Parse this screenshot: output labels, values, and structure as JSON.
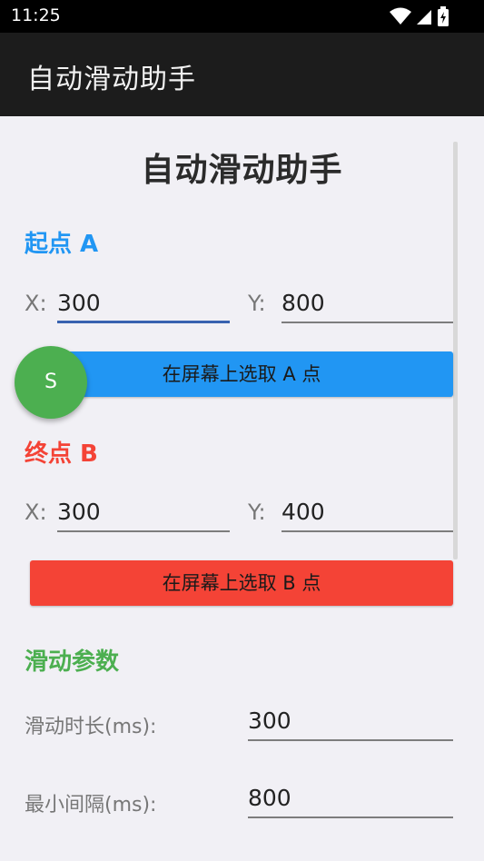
{
  "status": {
    "time": "11:25",
    "icons": [
      "wifi-icon",
      "signal-icon",
      "battery-icon"
    ]
  },
  "app_bar": {
    "title": "自动滑动助手"
  },
  "main": {
    "title": "自动滑动助手"
  },
  "start": {
    "heading": "起点 A",
    "heading_color": "#2196f3",
    "x_label": "X:",
    "x_value": "300",
    "y_label": "Y:",
    "y_value": "800",
    "button_label": "在屏幕上选取 A 点",
    "button_color": "#2196f3"
  },
  "fab": {
    "label": "S",
    "color": "#4caf50"
  },
  "end": {
    "heading": "终点 B",
    "heading_color": "#f44336",
    "x_label": "X:",
    "x_value": "300",
    "y_label": "Y:",
    "y_value": "400",
    "button_label": "在屏幕上选取 B 点",
    "button_color": "#f44336"
  },
  "params": {
    "heading": "滑动参数",
    "heading_color": "#4caf50",
    "duration_label": "滑动时长(ms):",
    "duration_value": "300",
    "interval_label": "最小间隔(ms):",
    "interval_value": "800"
  }
}
